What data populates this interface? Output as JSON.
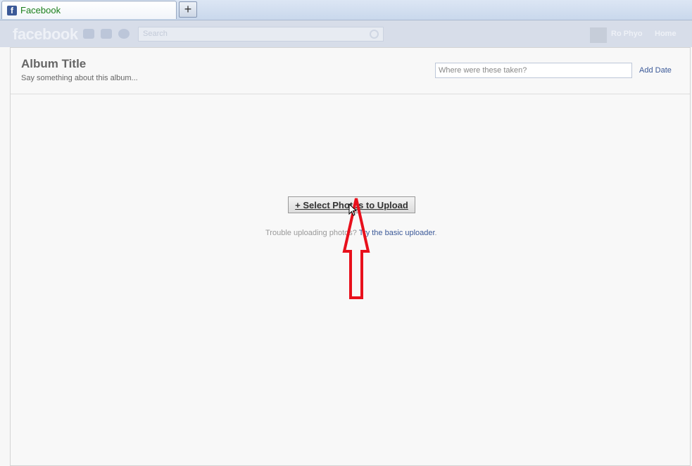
{
  "browser": {
    "tab_title": "Facebook",
    "new_tab_label": "+"
  },
  "fbbar": {
    "logo": "facebook",
    "search_placeholder": "Search",
    "user_name": "Ro Phyo",
    "home_label": "Home"
  },
  "album": {
    "title": "Album Title",
    "description_placeholder": "Say something about this album...",
    "location_placeholder": "Where were these taken?",
    "add_date_label": "Add Date"
  },
  "upload": {
    "select_button_label": "+ Select Photos to Upload",
    "trouble_text": "Trouble uploading photos?",
    "basic_uploader_link": "Try the basic uploader",
    "trailing_punct": "."
  },
  "colors": {
    "fb_blue": "#3b5998",
    "annotation_arrow": "#e8101c"
  },
  "icons": [
    "facebook-favicon",
    "friends-icon",
    "messages-icon",
    "notifications-globe-icon",
    "search-icon",
    "up-arrow-annotation-icon",
    "mouse-cursor-icon"
  ]
}
